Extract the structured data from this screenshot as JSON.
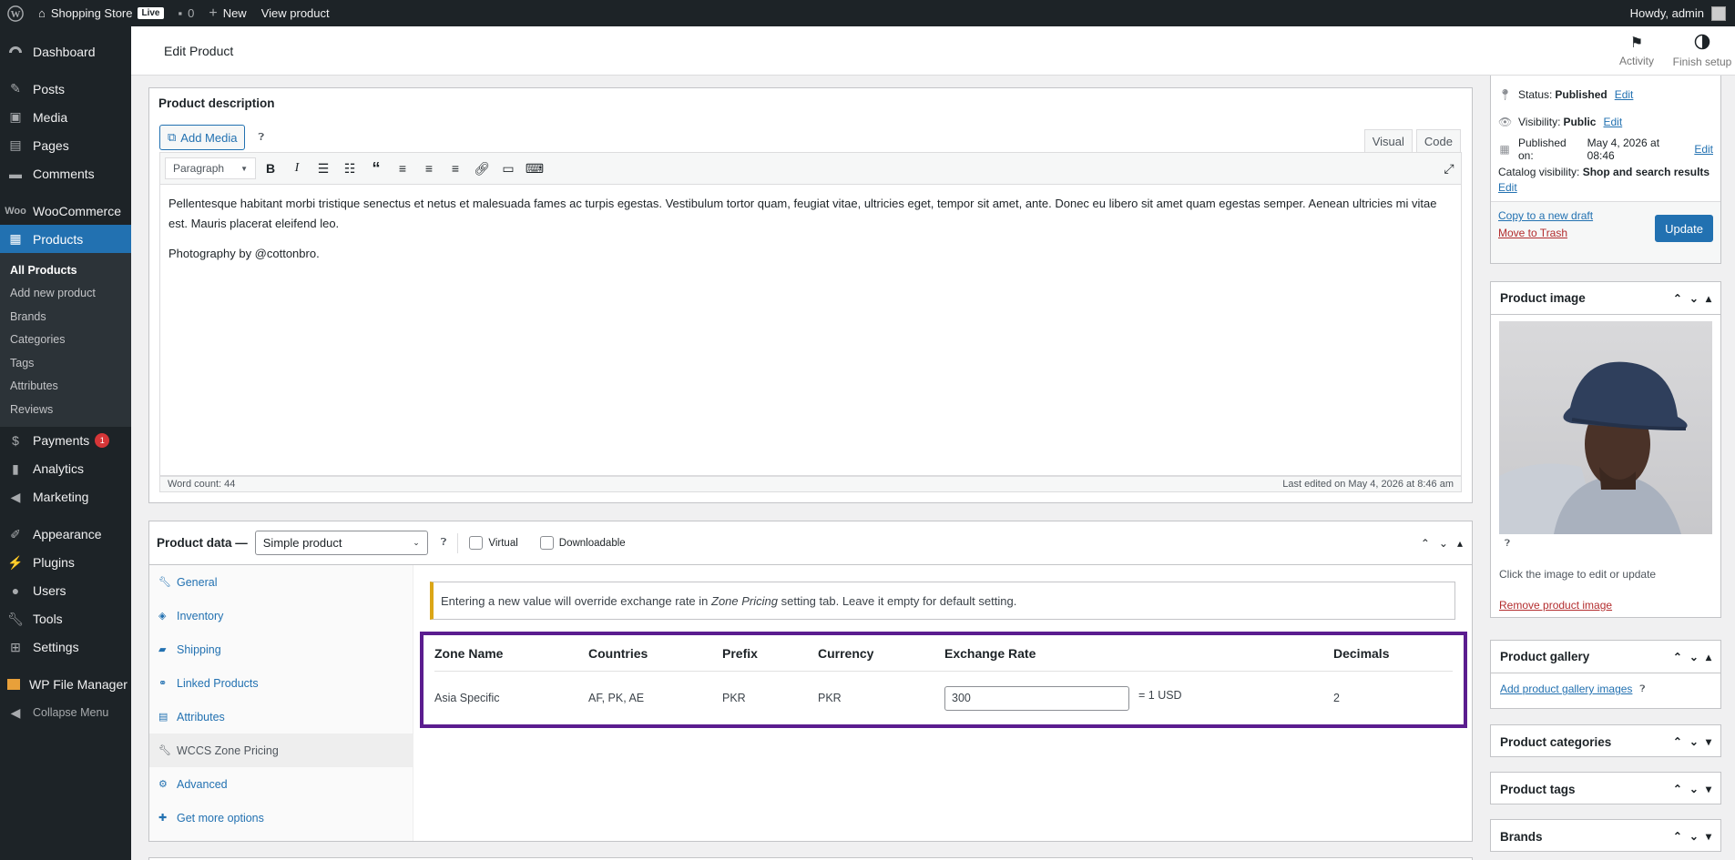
{
  "admin_bar": {
    "site_name": "Shopping Store",
    "live_badge": "Live",
    "comments_count": "0",
    "new_label": "New",
    "view_product": "View product",
    "howdy": "Howdy, admin"
  },
  "sidebar": {
    "items": [
      {
        "label": "Dashboard",
        "icon": "dashboard-icon"
      },
      {
        "label": "Posts",
        "icon": "pin-icon"
      },
      {
        "label": "Media",
        "icon": "media-icon"
      },
      {
        "label": "Pages",
        "icon": "page-icon"
      },
      {
        "label": "Comments",
        "icon": "comment-icon"
      },
      {
        "label": "WooCommerce",
        "icon": "woo-icon"
      },
      {
        "label": "Products",
        "icon": "box-icon"
      },
      {
        "label": "Payments",
        "icon": "dollar-icon",
        "badge": "1"
      },
      {
        "label": "Analytics",
        "icon": "chart-icon"
      },
      {
        "label": "Marketing",
        "icon": "megaphone-icon"
      },
      {
        "label": "Appearance",
        "icon": "brush-icon"
      },
      {
        "label": "Plugins",
        "icon": "plug-icon"
      },
      {
        "label": "Users",
        "icon": "user-icon"
      },
      {
        "label": "Tools",
        "icon": "wrench-icon"
      },
      {
        "label": "Settings",
        "icon": "settings-icon"
      },
      {
        "label": "WP File Manager",
        "icon": "folder-icon"
      },
      {
        "label": "Collapse Menu",
        "icon": "collapse-icon"
      }
    ],
    "products_submenu": [
      "All Products",
      "Add new product",
      "Brands",
      "Categories",
      "Tags",
      "Attributes",
      "Reviews"
    ]
  },
  "header": {
    "title": "Edit Product",
    "activity": "Activity",
    "finish_setup": "Finish setup"
  },
  "description": {
    "title": "Product description",
    "add_media": "Add Media",
    "tab_visual": "Visual",
    "tab_code": "Code",
    "format_select": "Paragraph",
    "paragraph1": "Pellentesque habitant morbi tristique senectus et netus et malesuada fames ac turpis egestas. Vestibulum tortor quam, feugiat vitae, ultricies eget, tempor sit amet, ante. Donec eu libero sit amet quam egestas semper. Aenean ultricies mi vitae est. Mauris placerat eleifend leo.",
    "paragraph2": "Photography by @cottonbro.",
    "word_count": "Word count: 44",
    "last_edited": "Last edited on May 4, 2026 at 8:46 am"
  },
  "product_data": {
    "title": "Product data —",
    "type_select": "Simple product",
    "virtual": "Virtual",
    "downloadable": "Downloadable",
    "tabs": [
      {
        "label": "General",
        "icon": "wrench-icon"
      },
      {
        "label": "Inventory",
        "icon": "tag-icon"
      },
      {
        "label": "Shipping",
        "icon": "truck-icon"
      },
      {
        "label": "Linked Products",
        "icon": "link-icon"
      },
      {
        "label": "Attributes",
        "icon": "list-icon"
      },
      {
        "label": "WCCS Zone Pricing",
        "icon": "wrench-icon"
      },
      {
        "label": "Advanced",
        "icon": "gear-icon"
      },
      {
        "label": "Get more options",
        "icon": "plugin-icon"
      }
    ],
    "notice_pre": "Entering a new value will override exchange rate in ",
    "notice_em": "Zone Pricing",
    "notice_post": " setting tab. Leave it empty for default setting.",
    "zone_table": {
      "headers": [
        "Zone Name",
        "Countries",
        "Prefix",
        "Currency",
        "Exchange Rate",
        "Decimals"
      ],
      "row": {
        "zone_name": "Asia Specific",
        "countries": "AF, PK, AE",
        "prefix": "PKR",
        "currency": "PKR",
        "exchange_rate": "300",
        "rate_suffix": "= 1 USD",
        "decimals": "2"
      }
    }
  },
  "publish": {
    "status_label": "Status:",
    "status_value": "Published",
    "visibility_label": "Visibility:",
    "visibility_value": "Public",
    "published_label": "Published on:",
    "published_value": "May 4, 2026 at 08:46",
    "catalog_label": "Catalog visibility:",
    "catalog_value": "Shop and search results",
    "edit": "Edit",
    "copy_draft": "Copy to a new draft",
    "move_trash": "Move to Trash",
    "update": "Update"
  },
  "product_image": {
    "title": "Product image",
    "help": "Click the image to edit or update",
    "remove": "Remove product image"
  },
  "product_gallery": {
    "title": "Product gallery",
    "add": "Add product gallery images"
  },
  "product_categories": {
    "title": "Product categories"
  },
  "product_tags": {
    "title": "Product tags"
  },
  "brands": {
    "title": "Brands"
  },
  "colors": {
    "accent": "#2271b1",
    "admin_bar": "#1d2327",
    "highlight_border": "#5b1d8f",
    "notice": "#dba617"
  }
}
